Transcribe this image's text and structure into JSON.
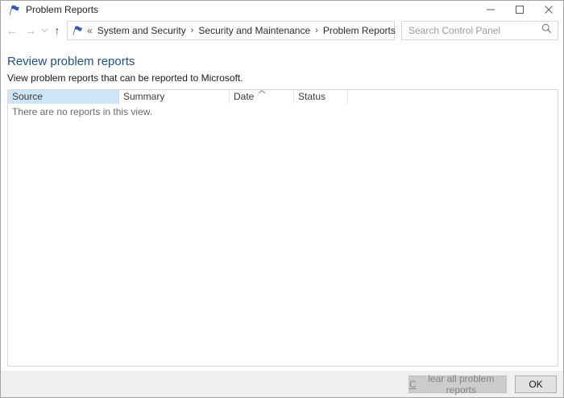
{
  "window": {
    "title": "Problem Reports",
    "icon": "blue-flag"
  },
  "toolbar": {
    "nav": {
      "back": "←",
      "forward": "→",
      "up": "↑"
    },
    "breadcrumb": {
      "prefix": "«",
      "separator": "›",
      "items": [
        "System and Security",
        "Security and Maintenance",
        "Problem Reports"
      ]
    },
    "search": {
      "placeholder": "Search Control Panel",
      "value": ""
    }
  },
  "main": {
    "heading": "Review problem reports",
    "subheading": "View problem reports that can be reported to Microsoft.",
    "list": {
      "columns": [
        "Source",
        "Summary",
        "Date",
        "Status"
      ],
      "sort": {
        "column": "Date",
        "direction": "ascending"
      },
      "rows": [],
      "empty_message": "There are no reports in this view."
    }
  },
  "footer": {
    "clear_button": {
      "accel": "C",
      "rest": "lear all problem reports",
      "enabled": false
    },
    "ok_button": "OK"
  },
  "colors": {
    "heading_blue": "#1d4f8b",
    "sorted_column_header_bg": "#cde5f7",
    "footer_bg": "#f0f0f0",
    "window_border": "#a3a3a3",
    "flag_icon_blue": "#2f5bb7",
    "disabled_button_bg": "#cccccc",
    "enabled_button_bg": "#e1e1e1"
  }
}
